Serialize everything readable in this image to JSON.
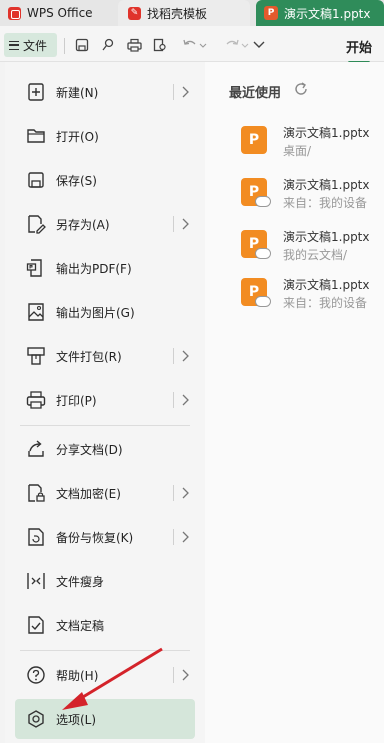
{
  "titlebar": {
    "tabs": [
      {
        "label": "WPS Office"
      },
      {
        "label": "找稻壳模板"
      },
      {
        "label": "演示文稿1.pptx"
      }
    ]
  },
  "toolbar": {
    "file_label": "文件",
    "start_tab": "开始"
  },
  "menu": {
    "items": [
      {
        "label": "新建(N)"
      },
      {
        "label": "打开(O)"
      },
      {
        "label": "保存(S)"
      },
      {
        "label": "另存为(A)"
      },
      {
        "label": "输出为PDF(F)"
      },
      {
        "label": "输出为图片(G)"
      },
      {
        "label": "文件打包(R)"
      },
      {
        "label": "打印(P)"
      },
      {
        "label": "分享文档(D)"
      },
      {
        "label": "文档加密(E)"
      },
      {
        "label": "备份与恢复(K)"
      },
      {
        "label": "文件瘦身"
      },
      {
        "label": "文档定稿"
      },
      {
        "label": "帮助(H)"
      },
      {
        "label": "选项(L)"
      }
    ]
  },
  "recent": {
    "title": "最近使用",
    "files": [
      {
        "name": "演示文稿1.pptx",
        "location": "桌面/"
      },
      {
        "name": "演示文稿1.pptx",
        "location": "来自：我的设备"
      },
      {
        "name": "演示文稿1.pptx",
        "location": "我的云文档/"
      },
      {
        "name": "演示文稿1.pptx",
        "location": "来自：我的设备"
      }
    ]
  },
  "colors": {
    "accent": "#2e8a57",
    "active_item": "#d5e6da",
    "pptx_icon": "#f28c22",
    "arrow": "#d4232a"
  }
}
